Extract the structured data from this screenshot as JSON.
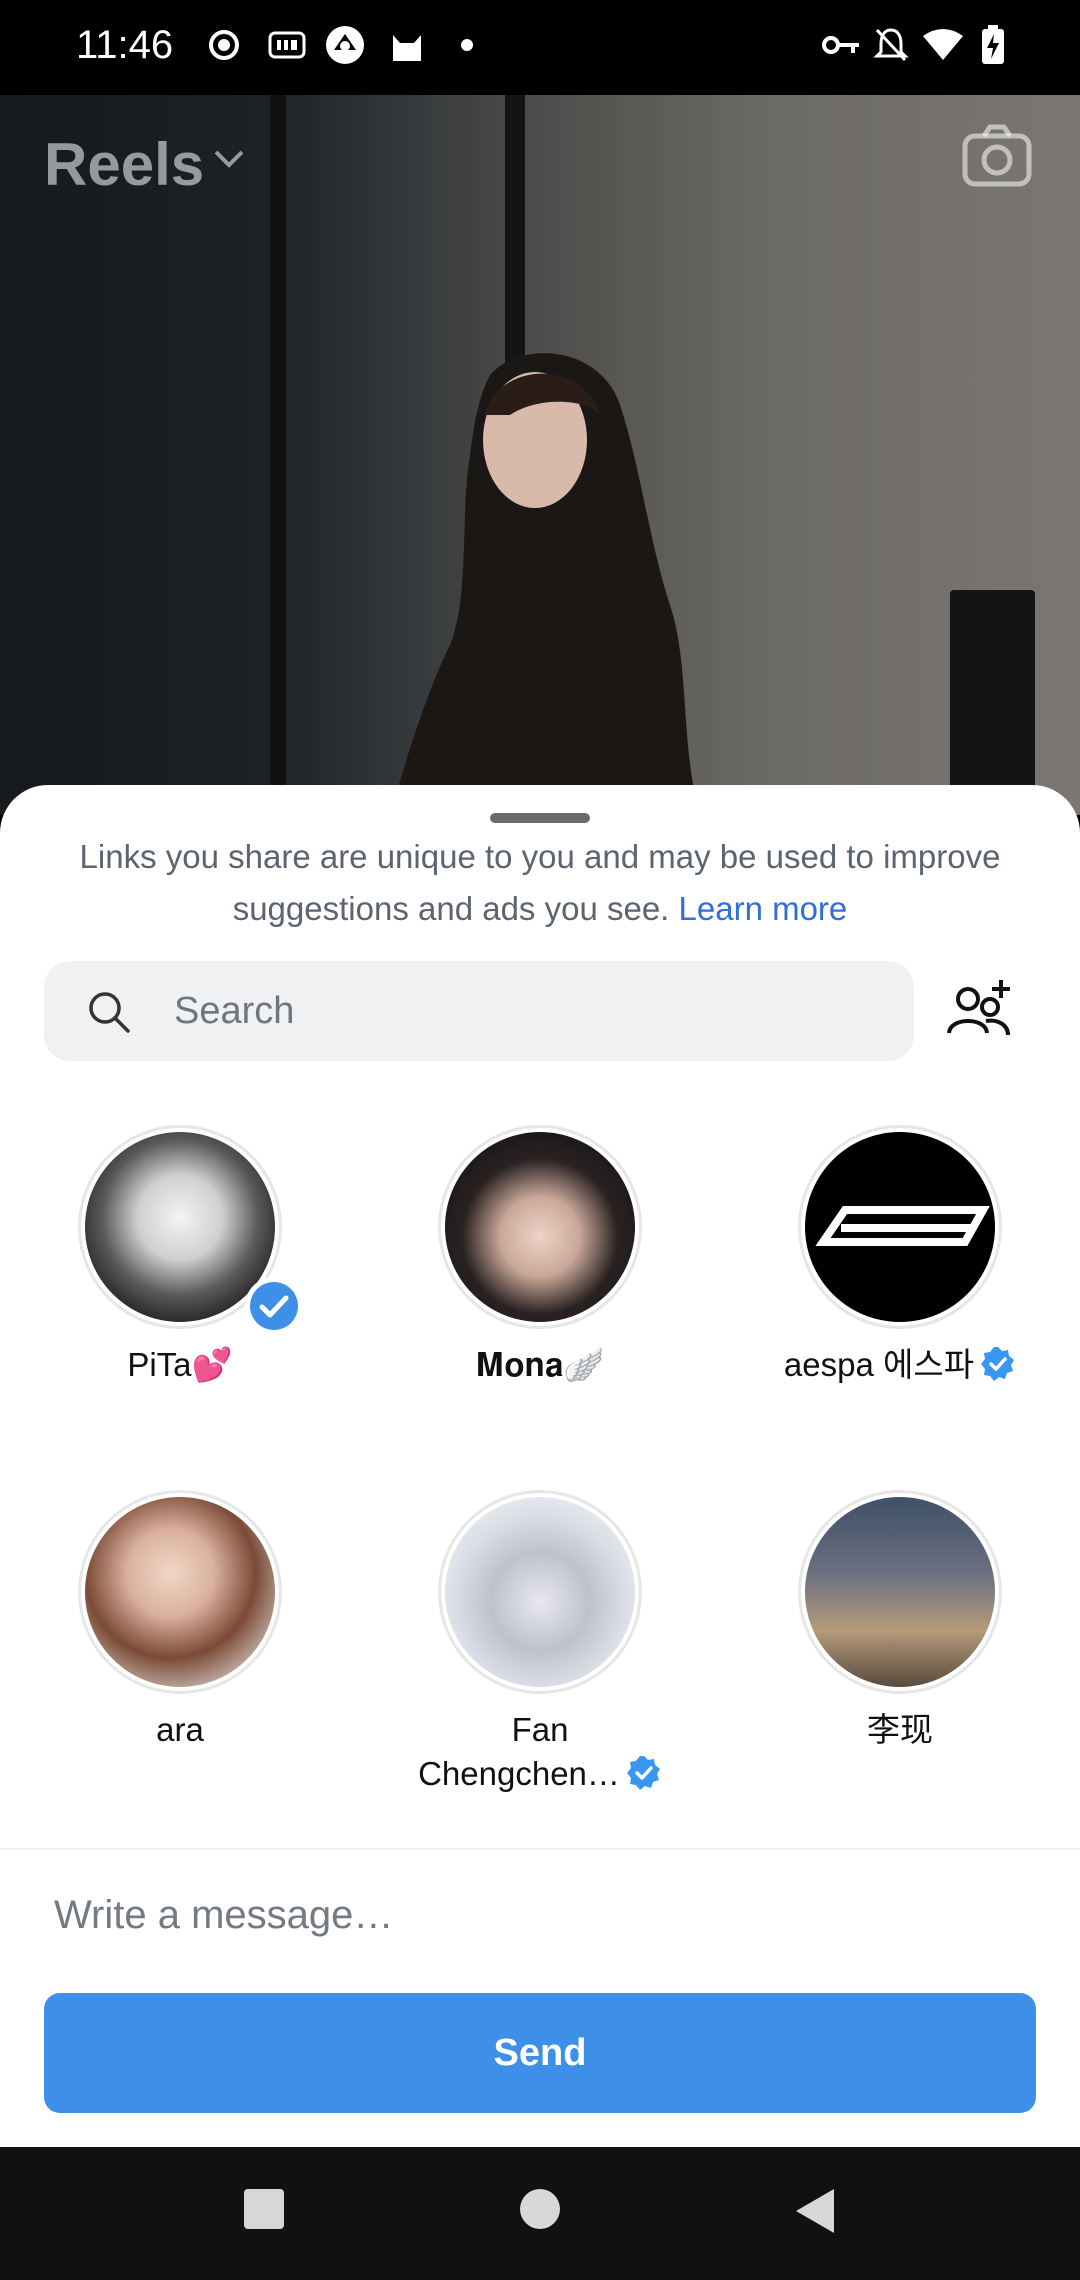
{
  "status_bar": {
    "time": "11:46",
    "icons": [
      "record-icon",
      "iqiyi-icon",
      "app-icon",
      "cat-icon",
      "dot-icon",
      "key-icon",
      "bell-off-icon",
      "wifi-icon",
      "battery-charging-icon"
    ]
  },
  "background": {
    "header_title": "Reels",
    "camera_icon": "camera-icon"
  },
  "sheet": {
    "notice_text": "Links you share are unique to you and may be used to improve suggestions and ads you see.",
    "learn_more": "Learn more",
    "search_placeholder": "Search",
    "contacts": [
      {
        "name": "PiTa💕",
        "selected": true,
        "verified": false
      },
      {
        "name": "𝐌𝐨𝐧𝐚🪽",
        "selected": false,
        "verified": false
      },
      {
        "name": "aespa 에스파",
        "selected": false,
        "verified": true
      },
      {
        "name": "ara",
        "selected": false,
        "verified": false
      },
      {
        "name": "Fan Chengchen…",
        "name_line1": "Fan",
        "name_line2": "Chengchen…",
        "selected": false,
        "verified": true
      },
      {
        "name": "李现",
        "selected": false,
        "verified": false
      }
    ],
    "message_placeholder": "Write a message…",
    "send_label": "Send"
  },
  "colors": {
    "accent": "#3d8fe8",
    "link": "#2f6fd6",
    "verified": "#3897f0"
  }
}
